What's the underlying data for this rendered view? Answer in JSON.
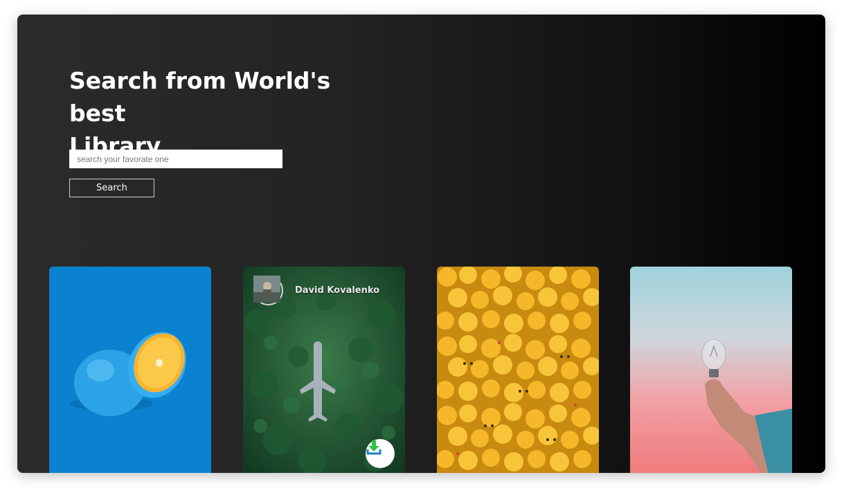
{
  "hero": {
    "title_line1": "Search from World's best",
    "title_line2": "Library"
  },
  "search": {
    "placeholder": "search your favorate one",
    "value": "",
    "button_label": "Search"
  },
  "cards": [
    {
      "subject": "orange-on-blue"
    },
    {
      "subject": "plane-in-forest",
      "author": "David Kovalenko",
      "download_icon": "download-icon"
    },
    {
      "subject": "yellow-toy-heads"
    },
    {
      "subject": "lightbulb-in-hand"
    }
  ],
  "colors": {
    "download_green": "#2bc44a",
    "download_blue": "#1d7fc9",
    "card1_bg": "#0a82d0"
  }
}
